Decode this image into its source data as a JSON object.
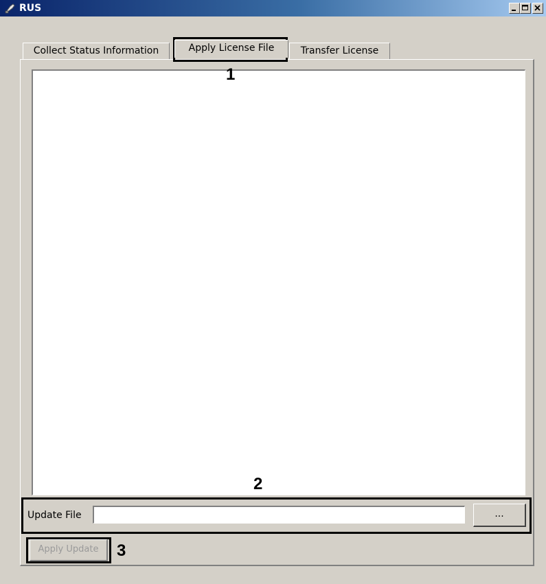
{
  "window": {
    "title": "RUS"
  },
  "titlebar_buttons": [
    "minimize-icon",
    "maximize-icon",
    "close-icon"
  ],
  "tabs": [
    {
      "label": "Collect Status Information",
      "active": false
    },
    {
      "label": "Apply License File",
      "active": true
    },
    {
      "label": "Transfer License",
      "active": false
    }
  ],
  "content": {
    "text_area": "",
    "update_file_label": "Update File",
    "update_file_value": "",
    "browse_label": "...",
    "apply_label": "Apply Update",
    "apply_enabled": false
  },
  "callouts": [
    "1",
    "2",
    "3"
  ],
  "colors": {
    "window_bg": "#d4d0c8",
    "titlebar_start": "#0a246a",
    "titlebar_end": "#a6caf0"
  }
}
